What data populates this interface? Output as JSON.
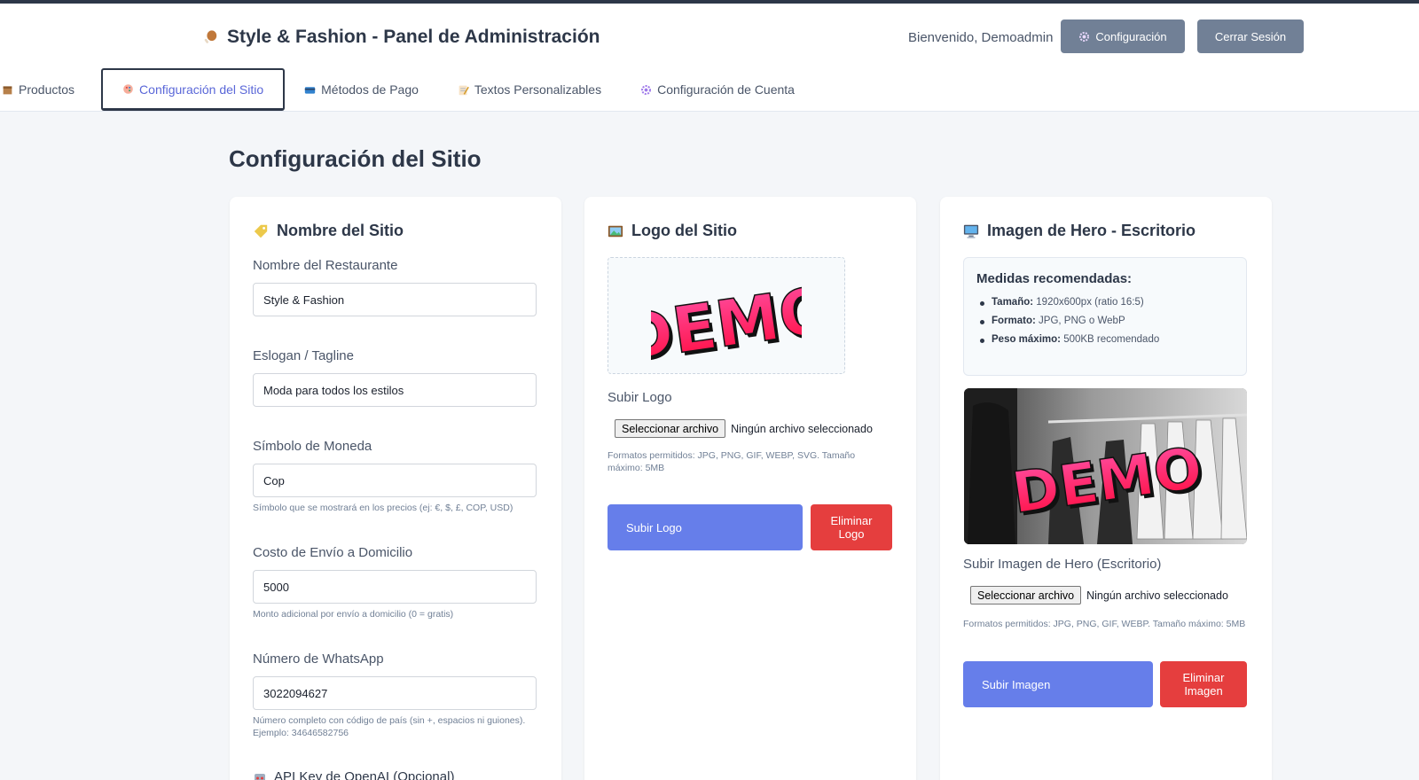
{
  "header": {
    "title": "Style & Fashion - Panel de Administración",
    "welcome": "Bienvenido, Demoadmin",
    "config_button": "Configuración",
    "logout_button": "Cerrar Sesión"
  },
  "tabs": [
    {
      "label": "Productos",
      "icon": "box-icon"
    },
    {
      "label": "Configuración del Sitio",
      "icon": "palette-icon",
      "active": true
    },
    {
      "label": "Métodos de Pago",
      "icon": "credit-card-icon"
    },
    {
      "label": "Textos Personalizables",
      "icon": "memo-icon"
    },
    {
      "label": "Configuración de Cuenta",
      "icon": "gear-icon"
    }
  ],
  "page_title": "Configuración del Sitio",
  "site_name_card": {
    "heading": "Nombre del Sitio",
    "restaurant_label": "Nombre del Restaurante",
    "restaurant_value": "Style & Fashion",
    "slogan_label": "Eslogan / Tagline",
    "slogan_value": "Moda para todos los estilos",
    "currency_label": "Símbolo de Moneda",
    "currency_value": "Cop",
    "currency_hint": "Símbolo que se mostrará en los precios (ej: €, $, £, COP, USD)",
    "shipping_label": "Costo de Envío a Domicilio",
    "shipping_value": "5000",
    "shipping_hint": "Monto adicional por envío a domicilio (0 = gratis)",
    "whatsapp_label": "Número de WhatsApp",
    "whatsapp_value": "3022094627",
    "whatsapp_hint": "Número completo con código de país (sin +, espacios ni guiones). Ejemplo: 34646582756",
    "api_heading": "API Key de OpenAI (Opcional)"
  },
  "logo_card": {
    "heading": "Logo del Sitio",
    "logo_text": "DEMO",
    "upload_label": "Subir Logo",
    "file_button": "Seleccionar archivo",
    "file_status": "Ningún archivo seleccionado",
    "formats_hint": "Formatos permitidos: JPG, PNG, GIF, WEBP, SVG. Tamaño máximo: 5MB",
    "upload_button": "Subir Logo",
    "delete_button": "Eliminar Logo"
  },
  "hero_card": {
    "heading": "Imagen de Hero - Escritorio",
    "rec_title": "Medidas recomendadas:",
    "rec_items": [
      {
        "key": "Tamaño:",
        "value": "1920x600px (ratio 16:5)"
      },
      {
        "key": "Formato:",
        "value": "JPG, PNG o WebP"
      },
      {
        "key": "Peso máximo:",
        "value": "500KB recomendado"
      }
    ],
    "hero_text": "DEMO",
    "upload_label": "Subir Imagen de Hero (Escritorio)",
    "file_button": "Seleccionar archivo",
    "file_status": "Ningún archivo seleccionado",
    "formats_hint": "Formatos permitidos: JPG, PNG, GIF, WEBP. Tamaño máximo: 5MB",
    "upload_button": "Subir Imagen",
    "delete_button": "Eliminar Imagen"
  },
  "colors": {
    "primary": "#667eea",
    "danger": "#e53e3e",
    "header_button": "#718096",
    "active_tab_text": "#5a67d8"
  }
}
